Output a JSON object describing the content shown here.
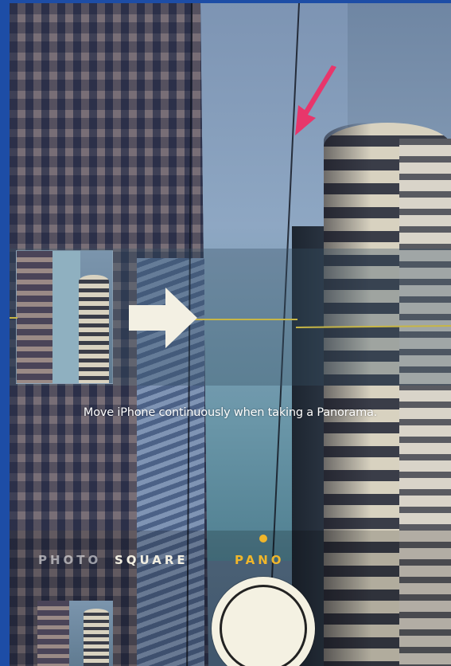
{
  "instruction": {
    "text": "Move iPhone continuously when taking a Panorama."
  },
  "camera_modes": {
    "items": [
      {
        "label": "PHOTO"
      },
      {
        "label": "SQUARE"
      },
      {
        "label": "PANO"
      }
    ],
    "selected": "PANO"
  },
  "colors": {
    "accent": "#f0b62b",
    "pointer": "#e8366b",
    "guide_line": "#c7b646",
    "border": "#1d4da6"
  },
  "icons": {
    "pano_direction": "arrow-right-icon",
    "pointer": "pink-pointer-arrow-icon",
    "shutter": "shutter-button-icon"
  }
}
